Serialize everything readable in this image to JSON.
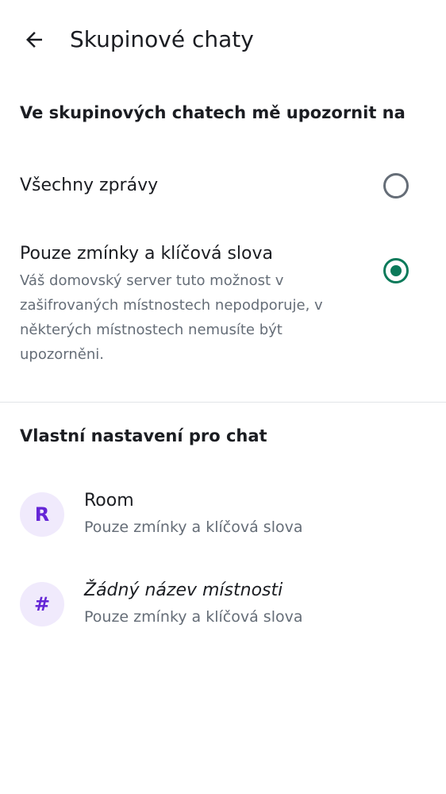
{
  "header": {
    "title": "Skupinové chaty",
    "back_icon": "arrow-left-icon"
  },
  "notify_section": {
    "heading": "Ve skupinových chatech mě upozornit na",
    "options": [
      {
        "label": "Všechny zprávy",
        "description": "",
        "selected": false
      },
      {
        "label": "Pouze zmínky a klíčová slova",
        "description": "Váš domovský server tuto možnost v zašifrovaných místnostech nepodporuje, v některých místnostech nemusíte být upozorněni.",
        "selected": true
      }
    ]
  },
  "custom_section": {
    "heading": "Vlastní nastavení pro chat",
    "rooms": [
      {
        "avatar_letter": "R",
        "name": "Room",
        "setting": "Pouze zmínky a klíčová slova"
      },
      {
        "avatar_letter": "#",
        "name": "Žádný název místnosti",
        "setting": "Pouze zmínky a klíčová slova"
      }
    ]
  },
  "colors": {
    "accent_green": "#0b7a5a",
    "avatar_bg": "#f0eafc",
    "avatar_fg": "#6526d6",
    "secondary_text": "#656d77"
  }
}
